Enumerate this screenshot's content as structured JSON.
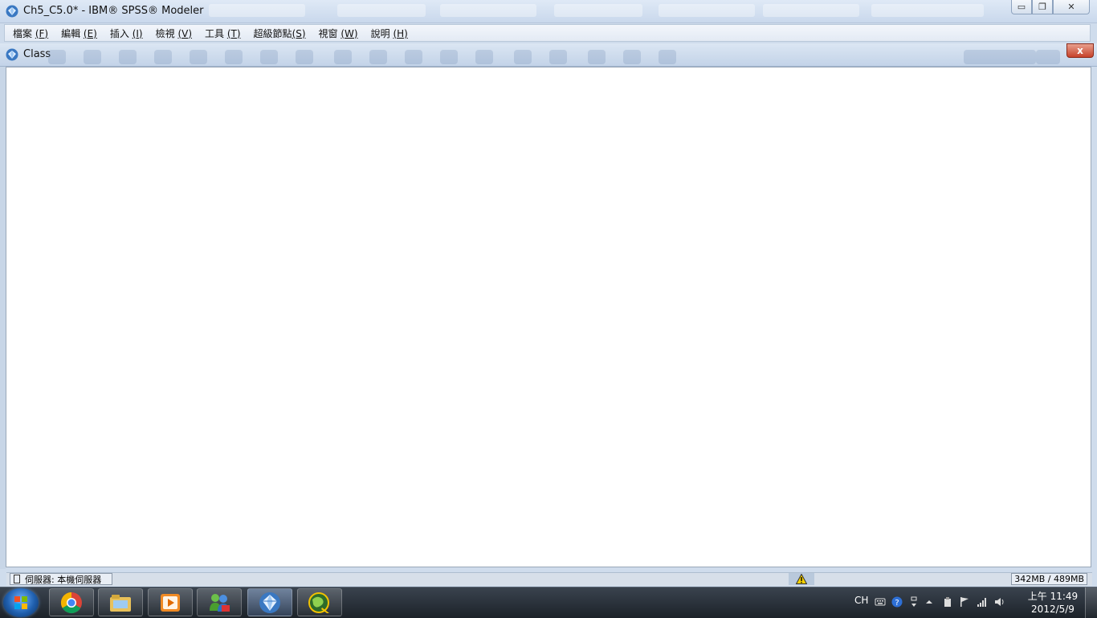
{
  "window": {
    "title": "Ch5_C5.0* - IBM® SPSS® Modeler",
    "minimize_glyph": "▭",
    "restore_glyph": "❐",
    "close_glyph": "✕"
  },
  "menu": {
    "items": [
      {
        "label": "檔案 ",
        "key": "(F)"
      },
      {
        "label": "編輯 ",
        "key": "(E)"
      },
      {
        "label": "插入 ",
        "key": "(I)"
      },
      {
        "label": "檢視 ",
        "key": "(V)"
      },
      {
        "label": "工具 ",
        "key": "(T)"
      },
      {
        "label": "超級節點",
        "key": "(S)"
      },
      {
        "label": "視窗 ",
        "key": "(W)"
      },
      {
        "label": "說明 ",
        "key": "(H)"
      }
    ]
  },
  "inner_window": {
    "title": "Class",
    "close_glyph": "x"
  },
  "status": {
    "server": "伺服器: 本機伺服器",
    "memory": "342MB / 489MB"
  },
  "taskbar": {
    "apps": [
      {
        "name": "chrome-icon"
      },
      {
        "name": "file-explorer-icon"
      },
      {
        "name": "media-player-icon"
      },
      {
        "name": "messenger-icon"
      },
      {
        "name": "spss-modeler-icon",
        "active": true
      },
      {
        "name": "globe-app-icon"
      }
    ],
    "language": "CH",
    "clock_time": "上午 11:49",
    "clock_date": "2012/5/9"
  },
  "colors": {
    "accent": "#1f5fae",
    "close_red": "#c7412a",
    "canvas": "#ffffff"
  }
}
